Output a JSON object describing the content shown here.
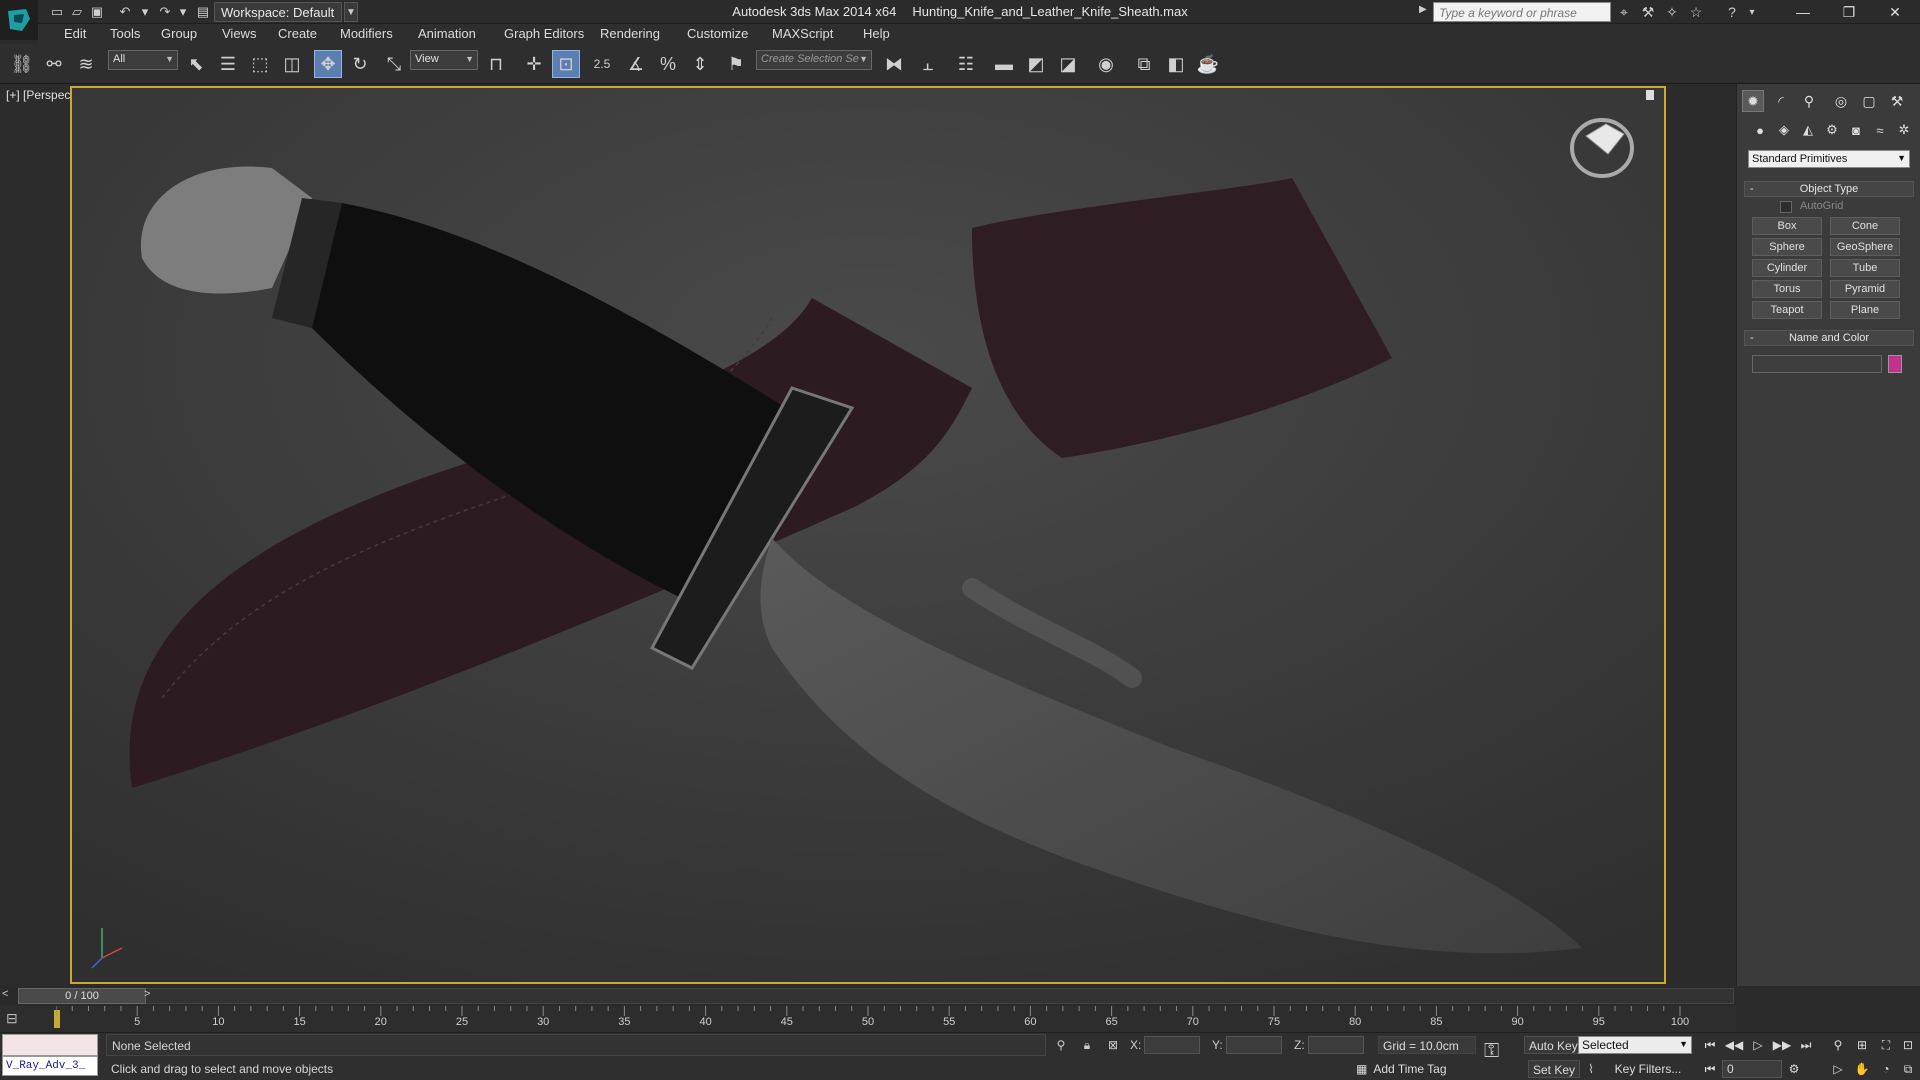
{
  "title": {
    "app": "Autodesk 3ds Max  2014 x64",
    "file": "Hunting_Knife_and_Leather_Knife_Sheath.max",
    "workspace": "Workspace: Default",
    "search_placeholder": "Type a keyword or phrase"
  },
  "menu": [
    "Edit",
    "Tools",
    "Group",
    "Views",
    "Create",
    "Modifiers",
    "Animation",
    "Graph Editors",
    "Rendering",
    "Customize",
    "MAXScript",
    "Help"
  ],
  "toolbar": {
    "selection_filter": "All",
    "ref_coord": "View",
    "snap_label": "2.5",
    "named_selection": "Create Selection Se"
  },
  "viewport": {
    "label": "[+] [Perspective ] [Shaded]"
  },
  "command_panel": {
    "category": "Standard Primitives",
    "object_type_header": "Object Type",
    "autogrid": "AutoGrid",
    "primitives": [
      "Box",
      "Cone",
      "Sphere",
      "GeoSphere",
      "Cylinder",
      "Tube",
      "Torus",
      "Pyramid",
      "Teapot",
      "Plane"
    ],
    "name_color_header": "Name and Color",
    "swatch_color": "#c4308e"
  },
  "timeline": {
    "frame": "0 / 100",
    "ticks": [
      "5",
      "10",
      "15",
      "20",
      "25",
      "30",
      "35",
      "40",
      "45",
      "50",
      "55",
      "60",
      "65",
      "70",
      "75",
      "80",
      "85",
      "90",
      "95",
      "100"
    ]
  },
  "status": {
    "maxscript": "V_Ray_Adv_3_",
    "selection": "None Selected",
    "prompt": "Click and drag to select and move objects",
    "x_label": "X:",
    "y_label": "Y:",
    "z_label": "Z:",
    "grid": "Grid = 10.0cm",
    "add_time_tag": "Add Time Tag",
    "auto_key": "Auto Key",
    "set_key": "Set Key",
    "selected": "Selected",
    "key_filters": "Key Filters...",
    "frame_input": "0"
  },
  "colors": {
    "viewport_border": "#c9a930",
    "accent": "#5a7fb0"
  }
}
